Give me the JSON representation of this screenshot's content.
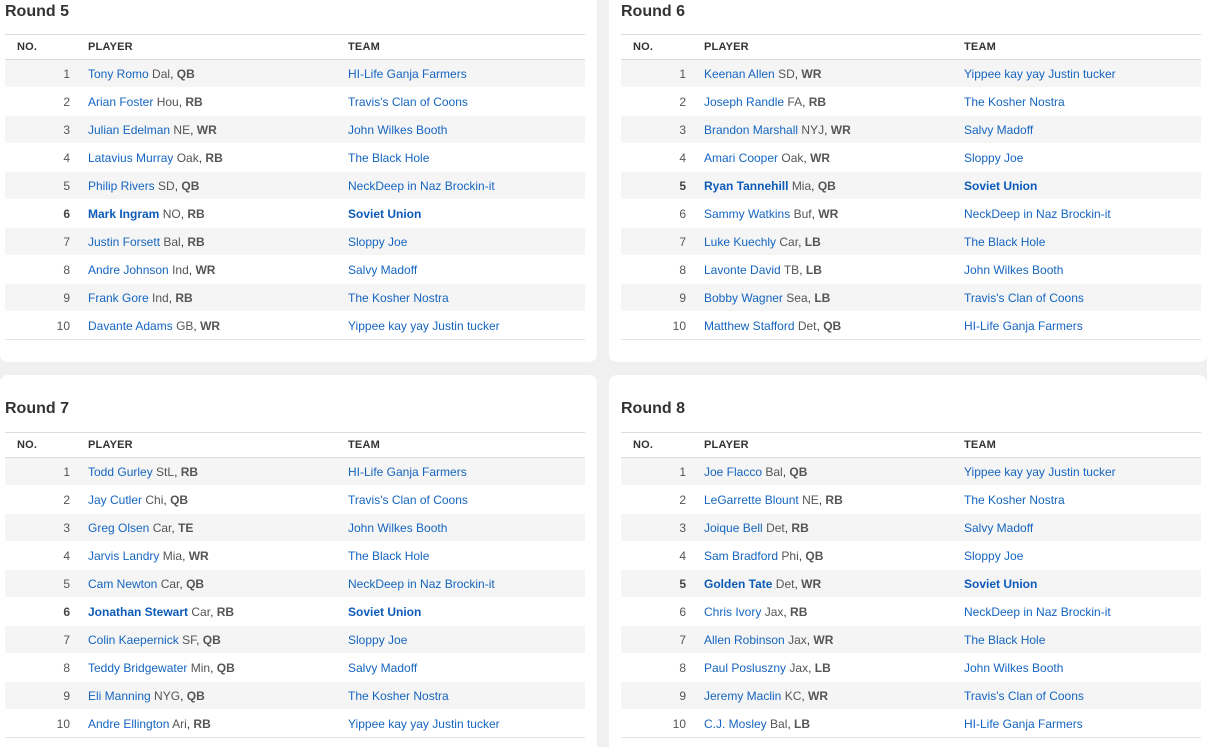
{
  "headers": {
    "no": "NO.",
    "player": "PLAYER",
    "team": "TEAM"
  },
  "rounds": [
    {
      "title": "Round 5",
      "picks": [
        {
          "no": "1",
          "player": "Tony Romo",
          "team_abbr": "Dal",
          "pos": "QB",
          "team": "HI-Life Ganja Farmers",
          "mine": false
        },
        {
          "no": "2",
          "player": "Arian Foster",
          "team_abbr": "Hou",
          "pos": "RB",
          "team": "Travis's Clan of Coons",
          "mine": false
        },
        {
          "no": "3",
          "player": "Julian Edelman",
          "team_abbr": "NE",
          "pos": "WR",
          "team": "John Wilkes Booth",
          "mine": false
        },
        {
          "no": "4",
          "player": "Latavius Murray",
          "team_abbr": "Oak",
          "pos": "RB",
          "team": "The Black Hole",
          "mine": false
        },
        {
          "no": "5",
          "player": "Philip Rivers",
          "team_abbr": "SD",
          "pos": "QB",
          "team": "NeckDeep in Naz Brockin-it",
          "mine": false
        },
        {
          "no": "6",
          "player": "Mark Ingram",
          "team_abbr": "NO",
          "pos": "RB",
          "team": "Soviet Union",
          "mine": true
        },
        {
          "no": "7",
          "player": "Justin Forsett",
          "team_abbr": "Bal",
          "pos": "RB",
          "team": "Sloppy Joe",
          "mine": false
        },
        {
          "no": "8",
          "player": "Andre Johnson",
          "team_abbr": "Ind",
          "pos": "WR",
          "team": "Salvy Madoff",
          "mine": false
        },
        {
          "no": "9",
          "player": "Frank Gore",
          "team_abbr": "Ind",
          "pos": "RB",
          "team": "The Kosher Nostra",
          "mine": false
        },
        {
          "no": "10",
          "player": "Davante Adams",
          "team_abbr": "GB",
          "pos": "WR",
          "team": "Yippee kay yay Justin tucker",
          "mine": false
        }
      ]
    },
    {
      "title": "Round 6",
      "picks": [
        {
          "no": "1",
          "player": "Keenan Allen",
          "team_abbr": "SD",
          "pos": "WR",
          "team": "Yippee kay yay Justin tucker",
          "mine": false
        },
        {
          "no": "2",
          "player": "Joseph Randle",
          "team_abbr": "FA",
          "pos": "RB",
          "team": "The Kosher Nostra",
          "mine": false
        },
        {
          "no": "3",
          "player": "Brandon Marshall",
          "team_abbr": "NYJ",
          "pos": "WR",
          "team": "Salvy Madoff",
          "mine": false
        },
        {
          "no": "4",
          "player": "Amari Cooper",
          "team_abbr": "Oak",
          "pos": "WR",
          "team": "Sloppy Joe",
          "mine": false
        },
        {
          "no": "5",
          "player": "Ryan Tannehill",
          "team_abbr": "Mia",
          "pos": "QB",
          "team": "Soviet Union",
          "mine": true
        },
        {
          "no": "6",
          "player": "Sammy Watkins",
          "team_abbr": "Buf",
          "pos": "WR",
          "team": "NeckDeep in Naz Brockin-it",
          "mine": false
        },
        {
          "no": "7",
          "player": "Luke Kuechly",
          "team_abbr": "Car",
          "pos": "LB",
          "team": "The Black Hole",
          "mine": false
        },
        {
          "no": "8",
          "player": "Lavonte David",
          "team_abbr": "TB",
          "pos": "LB",
          "team": "John Wilkes Booth",
          "mine": false
        },
        {
          "no": "9",
          "player": "Bobby Wagner",
          "team_abbr": "Sea",
          "pos": "LB",
          "team": "Travis's Clan of Coons",
          "mine": false
        },
        {
          "no": "10",
          "player": "Matthew Stafford",
          "team_abbr": "Det",
          "pos": "QB",
          "team": "HI-Life Ganja Farmers",
          "mine": false
        }
      ]
    },
    {
      "title": "Round 7",
      "picks": [
        {
          "no": "1",
          "player": "Todd Gurley",
          "team_abbr": "StL",
          "pos": "RB",
          "team": "HI-Life Ganja Farmers",
          "mine": false
        },
        {
          "no": "2",
          "player": "Jay Cutler",
          "team_abbr": "Chi",
          "pos": "QB",
          "team": "Travis's Clan of Coons",
          "mine": false
        },
        {
          "no": "3",
          "player": "Greg Olsen",
          "team_abbr": "Car",
          "pos": "TE",
          "team": "John Wilkes Booth",
          "mine": false
        },
        {
          "no": "4",
          "player": "Jarvis Landry",
          "team_abbr": "Mia",
          "pos": "WR",
          "team": "The Black Hole",
          "mine": false
        },
        {
          "no": "5",
          "player": "Cam Newton",
          "team_abbr": "Car",
          "pos": "QB",
          "team": "NeckDeep in Naz Brockin-it",
          "mine": false
        },
        {
          "no": "6",
          "player": "Jonathan Stewart",
          "team_abbr": "Car",
          "pos": "RB",
          "team": "Soviet Union",
          "mine": true
        },
        {
          "no": "7",
          "player": "Colin Kaepernick",
          "team_abbr": "SF",
          "pos": "QB",
          "team": "Sloppy Joe",
          "mine": false
        },
        {
          "no": "8",
          "player": "Teddy Bridgewater",
          "team_abbr": "Min",
          "pos": "QB",
          "team": "Salvy Madoff",
          "mine": false
        },
        {
          "no": "9",
          "player": "Eli Manning",
          "team_abbr": "NYG",
          "pos": "QB",
          "team": "The Kosher Nostra",
          "mine": false
        },
        {
          "no": "10",
          "player": "Andre Ellington",
          "team_abbr": "Ari",
          "pos": "RB",
          "team": "Yippee kay yay Justin tucker",
          "mine": false
        }
      ]
    },
    {
      "title": "Round 8",
      "picks": [
        {
          "no": "1",
          "player": "Joe Flacco",
          "team_abbr": "Bal",
          "pos": "QB",
          "team": "Yippee kay yay Justin tucker",
          "mine": false
        },
        {
          "no": "2",
          "player": "LeGarrette Blount",
          "team_abbr": "NE",
          "pos": "RB",
          "team": "The Kosher Nostra",
          "mine": false
        },
        {
          "no": "3",
          "player": "Joique Bell",
          "team_abbr": "Det",
          "pos": "RB",
          "team": "Salvy Madoff",
          "mine": false
        },
        {
          "no": "4",
          "player": "Sam Bradford",
          "team_abbr": "Phi",
          "pos": "QB",
          "team": "Sloppy Joe",
          "mine": false
        },
        {
          "no": "5",
          "player": "Golden Tate",
          "team_abbr": "Det",
          "pos": "WR",
          "team": "Soviet Union",
          "mine": true
        },
        {
          "no": "6",
          "player": "Chris Ivory",
          "team_abbr": "Jax",
          "pos": "RB",
          "team": "NeckDeep in Naz Brockin-it",
          "mine": false
        },
        {
          "no": "7",
          "player": "Allen Robinson",
          "team_abbr": "Jax",
          "pos": "WR",
          "team": "The Black Hole",
          "mine": false
        },
        {
          "no": "8",
          "player": "Paul Posluszny",
          "team_abbr": "Jax",
          "pos": "LB",
          "team": "John Wilkes Booth",
          "mine": false
        },
        {
          "no": "9",
          "player": "Jeremy Maclin",
          "team_abbr": "KC",
          "pos": "WR",
          "team": "Travis's Clan of Coons",
          "mine": false
        },
        {
          "no": "10",
          "player": "C.J. Mosley",
          "team_abbr": "Bal",
          "pos": "LB",
          "team": "HI-Life Ganja Farmers",
          "mine": false
        }
      ]
    }
  ]
}
